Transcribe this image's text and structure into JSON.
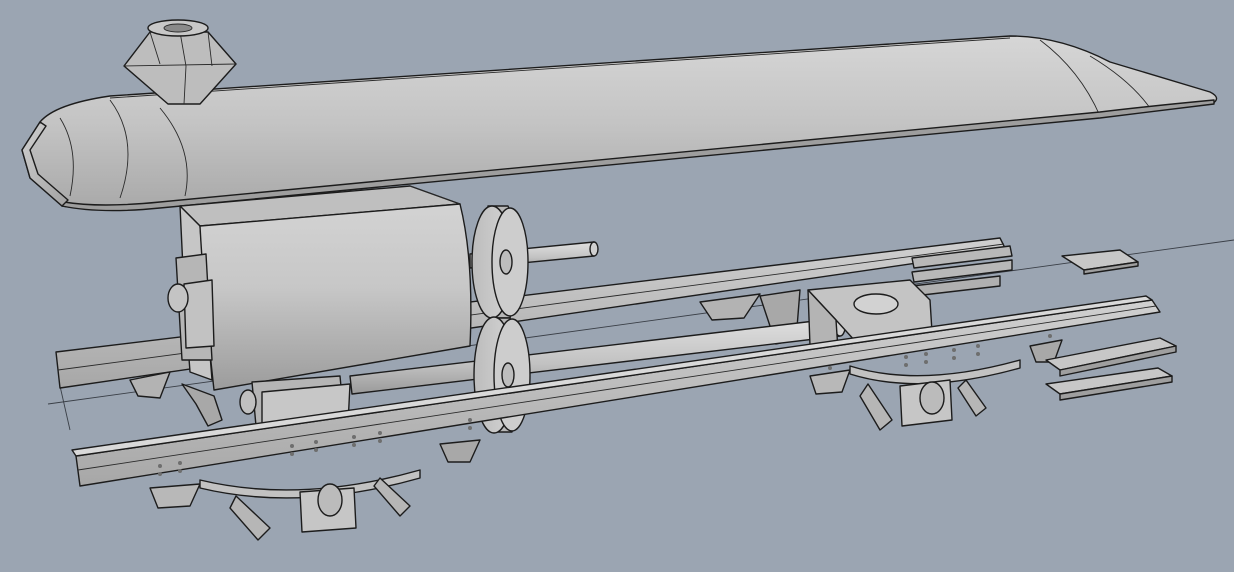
{
  "viewport": {
    "name": "Perspective",
    "background": "#9ba5b2",
    "display_mode": "shaded",
    "model_color": "#c9c9c9",
    "edge_color": "#1c1c1c"
  },
  "model": {
    "parts": [
      "boiler-top",
      "chimney",
      "cylinder-block",
      "flywheel-upper",
      "flywheel-lower",
      "piston-rod-upper",
      "piston-rod-lower",
      "frame-rail-front",
      "frame-rail-back",
      "crosshead",
      "leaf-spring-front-left",
      "leaf-spring-front-right",
      "axle-box-left",
      "axle-box-right",
      "small-plate-top",
      "small-plate-middle",
      "small-plate-bottom"
    ]
  }
}
